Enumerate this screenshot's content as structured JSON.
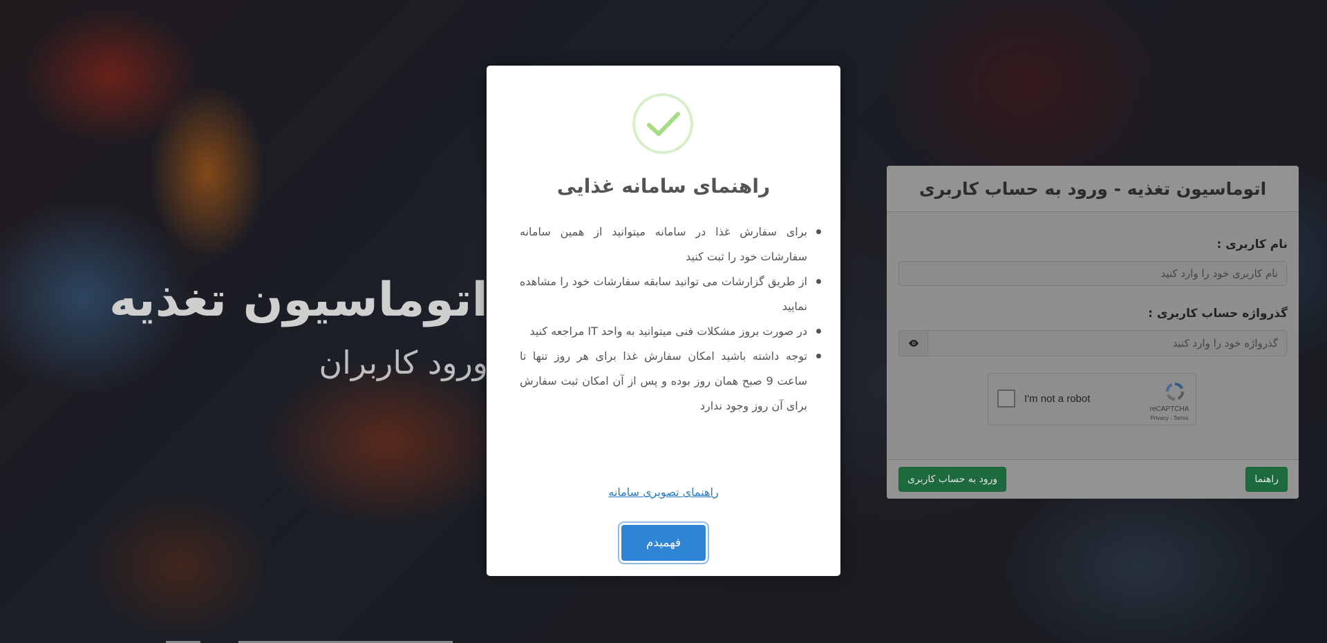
{
  "hero": {
    "title": "اتوماسیون تغذیه",
    "subtitle": "ورود کاربران"
  },
  "login": {
    "header": "اتوماسیون تغذیه - ورود به حساب کاربری",
    "username_label": "نام کاربری :",
    "username_placeholder": "نام کاربری خود را وارد کنید",
    "password_label": "گذرواژه حساب کاربری :",
    "password_placeholder": "گذرواژه خود را وارد کنید",
    "captcha": {
      "label": "I'm not a robot",
      "brand": "reCAPTCHA",
      "links": "Privacy - Terms"
    },
    "submit_label": "ورود به حساب کاربری",
    "help_label": "راهنما"
  },
  "modal": {
    "title": "راهنمای سامانه غذایی",
    "items": [
      "برای سفارش غذا در سامانه میتوانید از همین سامانه سفارشات خود را ثبت کنید",
      "از طریق گزارشات می توانید سابقه سفارشات خود را مشاهده نمایید",
      "در صورت بروز مشکلات فنی میتوانید به واحد IT مراجعه کنید",
      "توجه داشته باشید امکان سفارش غذا برای هر روز تنها تا ساعت 9 صبح همان روز بوده و پس از آن امکان ثبت سفارش برای آن روز وجود ندارد"
    ],
    "link_label": "راهنمای تصویری سامانه",
    "confirm_label": "فهمیدم"
  },
  "colors": {
    "success_check": "#a5dc86",
    "primary_button": "#3085d6",
    "green_button": "#1d6a3e"
  }
}
